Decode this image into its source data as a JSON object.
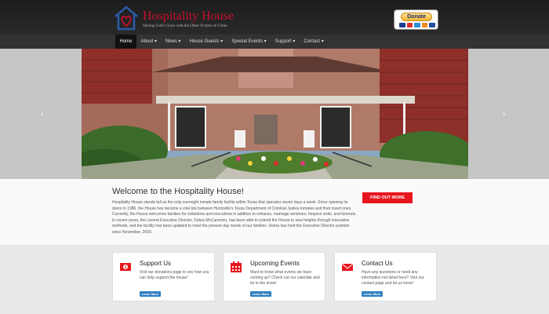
{
  "header": {
    "site_title": "Hospitality House",
    "tagline": "Sharing God's Grace with the Other Victims of Crime",
    "donate_label": "Donate"
  },
  "nav": [
    {
      "label": "Home"
    },
    {
      "label": "About ▾"
    },
    {
      "label": "News ▾"
    },
    {
      "label": "House Guests ▾"
    },
    {
      "label": "Special Events ▾"
    },
    {
      "label": "Support ▾"
    },
    {
      "label": "Contact ▾"
    }
  ],
  "slider": {
    "prev_arrow": "‹",
    "next_arrow": "›"
  },
  "welcome": {
    "title": "Welcome to the Hospitality House!",
    "body": "Hospitality House stands tall as the only overnight inmate family facility within Texas that operates seven days a week. Since opening its doors in 1986, the House has become a vital link between Huntsville's Texas Department of Criminal Justice inmates and their loved ones. Currently, the House welcomes families for visitations and executions in addition to releases, marriage seminars, hospice visits, and funerals. In recent years, the current Executive Director, Debra McCammon, has been able to extend the House to new heights through innovative methods, and the facility has been updated to meet the present day needs of our families. Debra has held the Executive Director position since November, 2009.",
    "button": "FIND OUT MORE"
  },
  "cards": [
    {
      "title": "Support Us",
      "text": "Visit our donations page to see how you can help support the house!",
      "button": "Learn More",
      "icon": "money-icon"
    },
    {
      "title": "Upcoming Events",
      "text": "Want to know what events we have coming up? Check out our calendar and be in the know!",
      "button": "Learn More",
      "icon": "calendar-icon"
    },
    {
      "title": "Contact Us",
      "text": "Have any questions or need any information not listed here? Visit our contact page and let us know!",
      "button": "Learn More",
      "icon": "envelope-icon"
    }
  ],
  "colors": {
    "accent_red": "#e8161e",
    "link_blue": "#2f7fc2",
    "header_dark": "#1c1c1c"
  }
}
